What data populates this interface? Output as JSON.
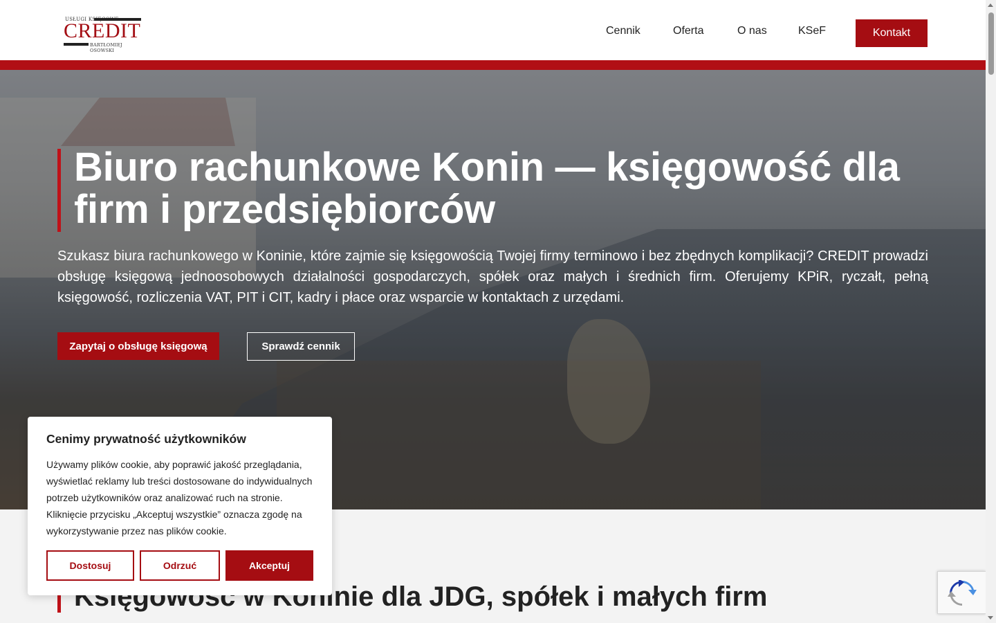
{
  "header": {
    "logo": {
      "top_text": "USŁUGI KSIĘGOWE",
      "word": "CREDIT",
      "bottom_text": "BARTŁOMIEJ OSOWSKI"
    },
    "nav": [
      {
        "label": "Cennik"
      },
      {
        "label": "Oferta"
      },
      {
        "label": "O nas"
      },
      {
        "label": "KSeF"
      }
    ],
    "contact_button": "Kontakt",
    "brand_color": "#a50d12"
  },
  "hero": {
    "title": "Biuro rachunkowe Konin — księgowość dla firm i przedsiębiorców",
    "lead": "Szukasz biura rachunkowego w Koninie, które zajmie się księgowością Twojej firmy terminowo i bez zbędnych komplikacji? CREDIT prowadzi obsługę księgową jednoosobowych działalności gospodarczych, spółek oraz małych i średnich firm. Oferujemy KPiR, ryczałt, pełną księgowość, rozliczenia VAT, PIT i CIT, kadry i płace oraz wsparcie w kontaktach z urzędami.",
    "primary_button": "Zapytaj o obsługę księgową",
    "secondary_button": "Sprawdź cennik"
  },
  "section2": {
    "title": "Księgowość w Koninie dla JDG, spółek i małych firm"
  },
  "cookie": {
    "title": "Cenimy prywatność użytkowników",
    "text": "Używamy plików cookie, aby poprawić jakość przeglądania, wyświetlać reklamy lub treści dostosowane do indywidualnych potrzeb użytkowników oraz analizować ruch na stronie. Kliknięcie przycisku „Akceptuj wszystkie” oznacza zgodę na wykorzystywanie przez nas plików cookie.",
    "customize": "Dostosuj",
    "reject": "Odrzuć",
    "accept": "Akceptuj"
  }
}
